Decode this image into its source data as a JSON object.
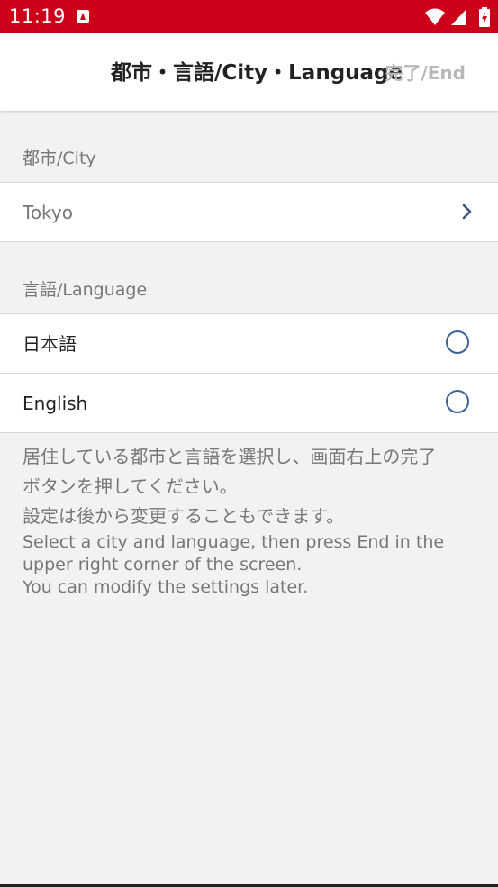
{
  "status_bar": {
    "time": "11:19",
    "background": "#cc0019"
  },
  "header": {
    "title": "都市・言語/City・Language",
    "done_label": "完了/End"
  },
  "city_section": {
    "label": "都市/City",
    "selected_city": "Tokyo"
  },
  "language_section": {
    "label": "言語/Language",
    "options": [
      {
        "label": "日本語",
        "selected": false
      },
      {
        "label": "English",
        "selected": false
      }
    ]
  },
  "description": {
    "jp_line1": "居住している都市と言語を選択し、画面右上の完了",
    "jp_line2": "ボタンを押してください。",
    "jp_line3": "設定は後から変更することもできます。",
    "en_line1": "Select a city and language, then press End in the",
    "en_line2": "upper right corner of the screen.",
    "en_line3": "You can modify the settings later."
  },
  "colors": {
    "accent_radio": "#3d6494",
    "status_red": "#cc0019"
  }
}
